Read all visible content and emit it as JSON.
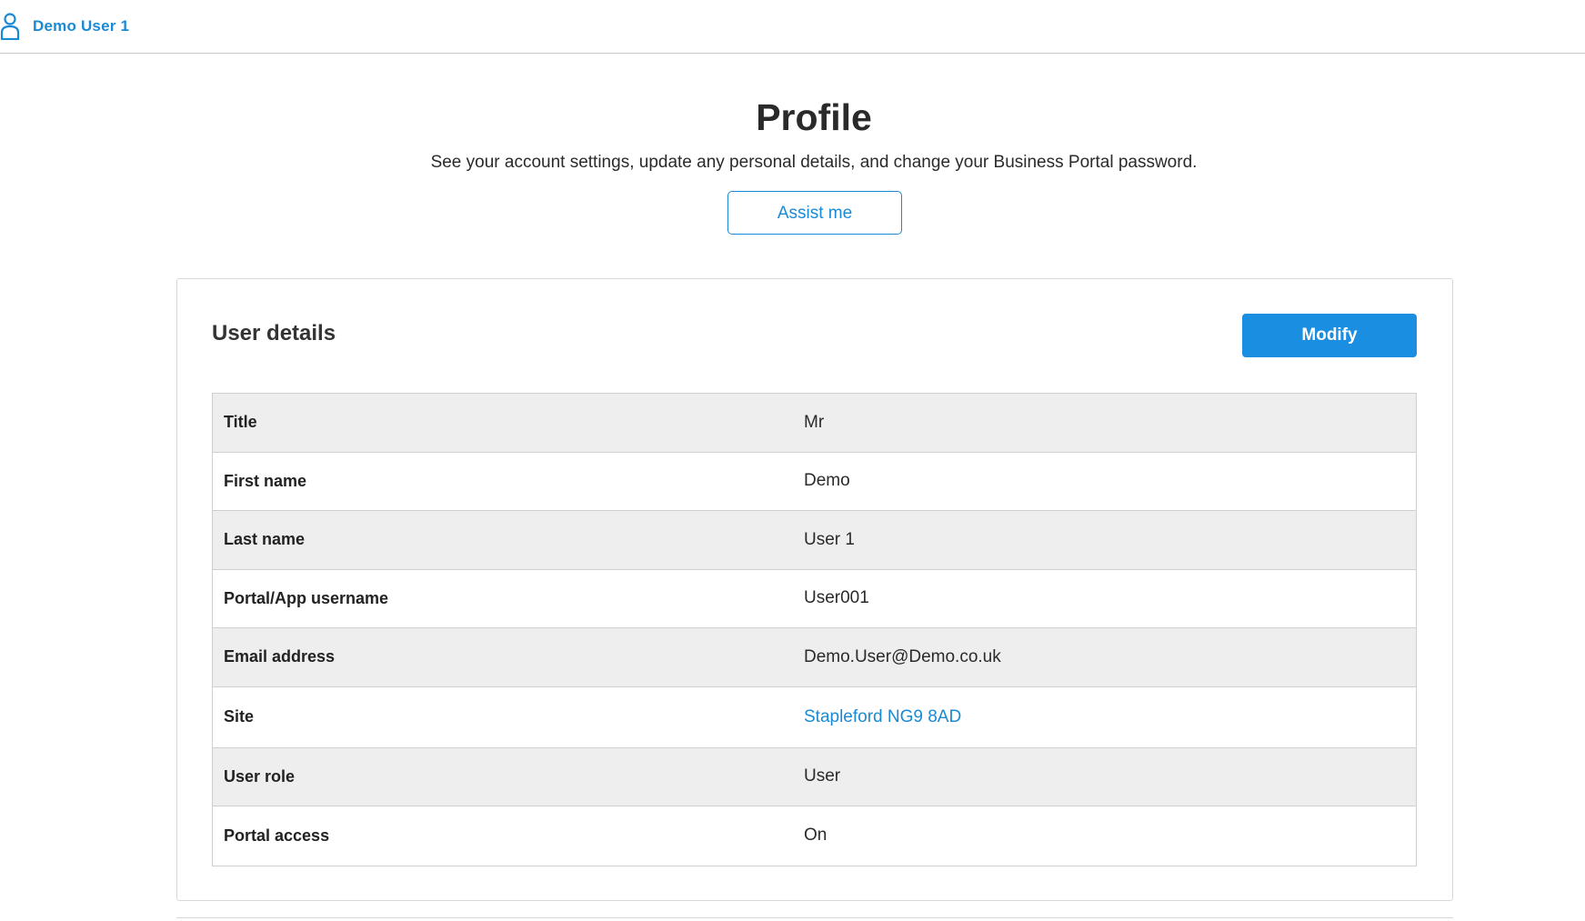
{
  "topbar": {
    "user_name": "Demo User 1"
  },
  "header": {
    "title": "Profile",
    "subtitle": "See your account settings, update any personal details, and change your Business Portal password.",
    "assist_label": "Assist me"
  },
  "card": {
    "title": "User details",
    "modify_label": "Modify",
    "rows": [
      {
        "label": "Title",
        "value": "Mr"
      },
      {
        "label": "First name",
        "value": "Demo"
      },
      {
        "label": "Last name",
        "value": "User 1"
      },
      {
        "label": "Portal/App username",
        "value": "User001"
      },
      {
        "label": "Email address",
        "value": "Demo.User@Demo.co.uk"
      },
      {
        "label": "Site",
        "value": "Stapleford NG9 8AD"
      },
      {
        "label": "User role",
        "value": "User"
      },
      {
        "label": "Portal access",
        "value": "On"
      }
    ]
  },
  "colors": {
    "accent": "#1a8ad4",
    "primary_button": "#1a8ee0",
    "row_shade": "#eeeeee"
  },
  "icons": {
    "user": "user-icon"
  }
}
